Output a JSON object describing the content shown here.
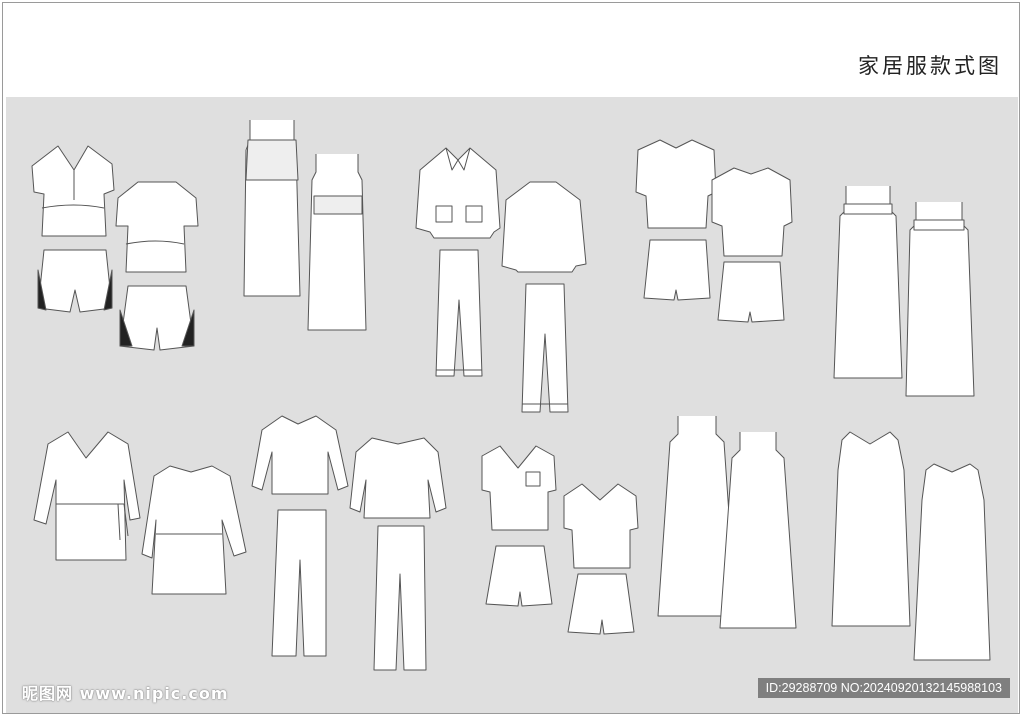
{
  "title": "家居服款式图",
  "watermark": {
    "brand": "昵图网",
    "url": "www.nipic.com",
    "id_line": "ID:29288709 NO:20240920132145988103"
  },
  "colors": {
    "panel": "#dfdfdf",
    "garment_fill": "#ffffff",
    "garment_stroke": "#555555",
    "lace": "#222222"
  },
  "illustrations": [
    "lace-trim-top-and-shorts-set",
    "lace-slip-dress",
    "notched-collar-pajama-set",
    "keyhole-top-and-shorts-set",
    "ruffle-strap-nightdress",
    "wrap-robe",
    "ruched-neck-top-and-pants-set",
    "v-neck-tee-and-shorts-set",
    "keyhole-strap-nightdress",
    "sleeveless-keyhole-nightdress"
  ]
}
